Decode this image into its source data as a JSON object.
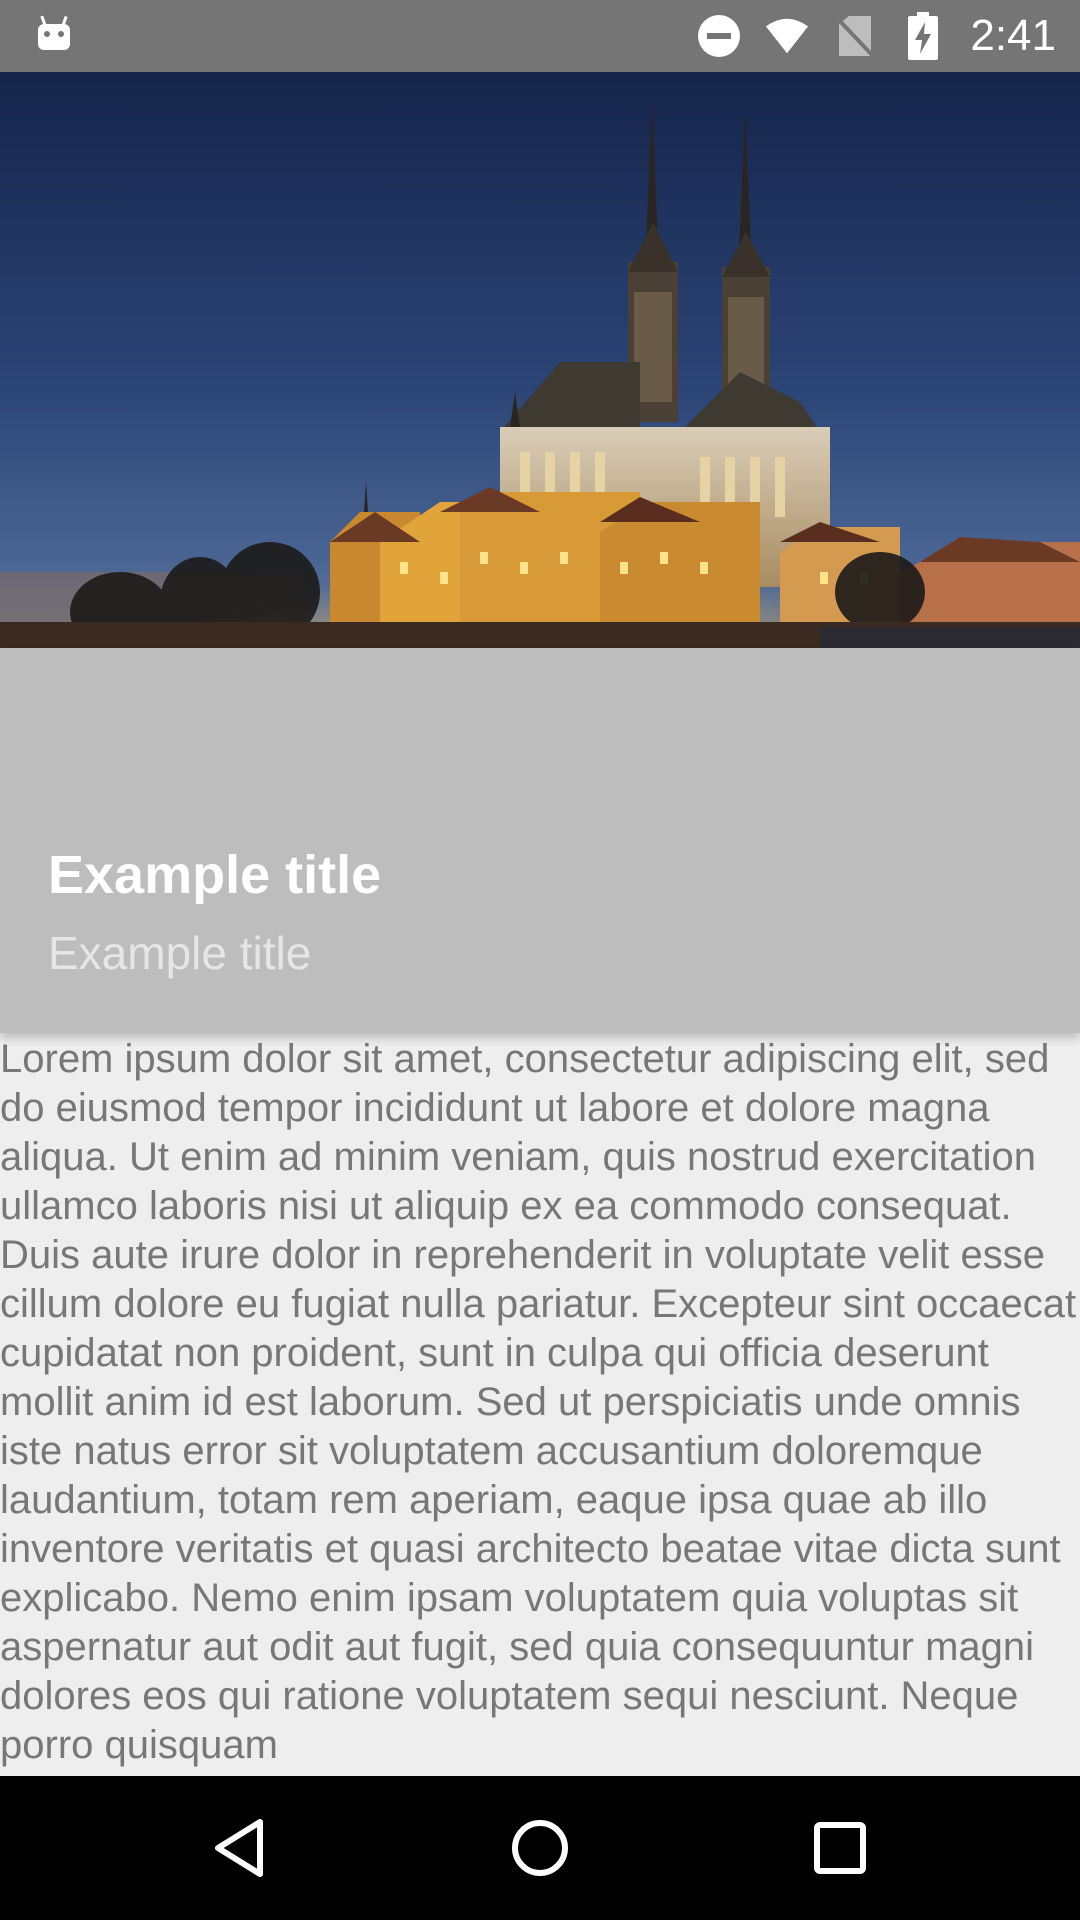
{
  "status_bar": {
    "time": "2:41",
    "icons": [
      "android-icon",
      "do-not-disturb-icon",
      "wifi-icon",
      "no-sim-icon",
      "battery-charging-icon"
    ]
  },
  "hero": {
    "image_subject": "illuminated gothic cathedral at dusk"
  },
  "header": {
    "title": "Example title",
    "subtitle": "Example title"
  },
  "content": {
    "body": "Lorem ipsum dolor sit amet, consectetur adipiscing elit, sed do eiusmod tempor incididunt ut labore et dolore magna aliqua. Ut enim ad minim veniam, quis nostrud exercitation ullamco laboris nisi ut aliquip ex ea com­modo consequat. Duis aute irure dolor in reprehenderit in voluptate velit esse cillum dolore eu fugiat nulla pariatur. Excepteur sint occaecat cupidatat non proident, sunt in culpa qui officia deserunt mollit anim id est laborum. Sed ut perspiciatis unde omnis iste natus error sit voluptatem accusantium doloremque laudantium, totam rem aperiam, eaque ipsa quae ab illo inventore veritatis et quasi architecto beatae vitae dicta sunt explicabo. Nemo enim ipsam voluptatem quia voluptas sit aspernatur aut odit aut fugit, sed quia consequuntur magni dolores eos qui ratione voluptatem sequi nesciunt. Neque porro quisquam"
  },
  "nav_bar": {
    "buttons": [
      "back-icon",
      "home-icon",
      "recents-icon"
    ]
  },
  "colors": {
    "status_bar": "#757575",
    "title_panel": "#bdbdbd",
    "body_text": "#777777",
    "background": "#eeeeee",
    "nav_bar": "#000000"
  }
}
